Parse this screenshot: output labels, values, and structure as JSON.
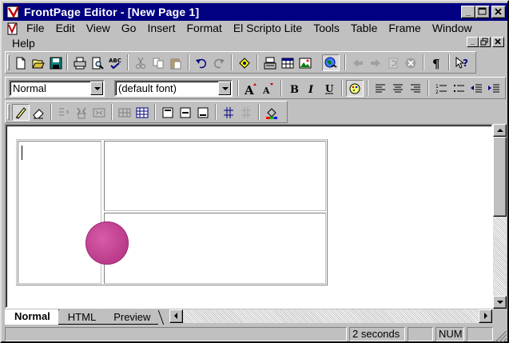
{
  "window": {
    "title": "FrontPage Editor - [New Page 1]"
  },
  "menu": {
    "row1": [
      "File",
      "Edit",
      "View",
      "Go",
      "Insert",
      "Format",
      "El Scripto Lite",
      "Tools",
      "Table",
      "Frame",
      "Window"
    ],
    "row2": [
      "Help"
    ]
  },
  "format_toolbar": {
    "style_value": "Normal",
    "font_value": "(default font)"
  },
  "tabs": [
    "Normal",
    "HTML",
    "Preview"
  ],
  "status": {
    "message": "",
    "time": "2 seconds",
    "panel2": "",
    "num": "NUM",
    "panel4": ""
  },
  "colors": {
    "titlebar": "#000080",
    "circle": "#c8489a"
  },
  "icons": {
    "toolbar1": [
      "new-icon",
      "open-icon",
      "save-icon",
      "print-icon",
      "print-preview-icon",
      "spelling-icon",
      "cut-icon",
      "copy-icon",
      "paste-icon",
      "undo-icon",
      "redo-icon",
      "webbot-icon",
      "form-field-icon",
      "insert-table-icon",
      "insert-image-icon",
      "hyperlink-icon",
      "back-icon",
      "forward-icon",
      "refresh-icon",
      "stop-icon",
      "show-all-icon",
      "help-icon"
    ],
    "toolbar2": [
      "increase-text-size-icon",
      "decrease-text-size-icon",
      "bold-icon",
      "italic-icon",
      "underline-icon",
      "text-color-icon",
      "align-left-icon",
      "center-icon",
      "align-right-icon",
      "numbered-list-icon",
      "bulleted-list-icon",
      "decrease-indent-icon",
      "increase-indent-icon"
    ],
    "toolbar3": [
      "draw-table-icon",
      "eraser-icon",
      "insert-rows-icon",
      "split-cells-icon",
      "merge-cells-icon",
      "insert-cell-icon",
      "insert-table-icon",
      "align-top-icon",
      "center-vertically-icon",
      "align-bottom-icon",
      "distribute-rows-icon",
      "distribute-columns-icon",
      "background-color-icon"
    ]
  }
}
